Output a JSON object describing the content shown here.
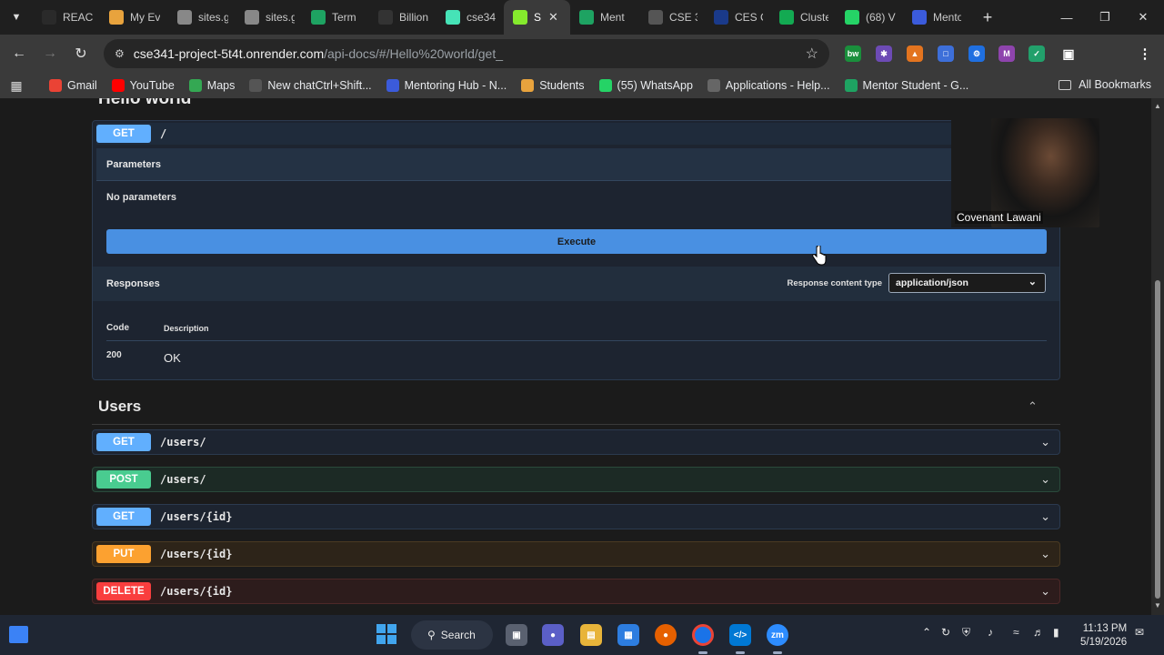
{
  "browser": {
    "tabs": [
      {
        "label": "REAC",
        "icon": "openai-icon",
        "color": "#2a2a2a",
        "active": false
      },
      {
        "label": "My Ev",
        "icon": "people-icon",
        "color": "#e8a33d",
        "active": false
      },
      {
        "label": "sites.g",
        "icon": "page-icon",
        "color": "#888888",
        "active": false
      },
      {
        "label": "sites.g",
        "icon": "page-icon",
        "color": "#888888",
        "active": false
      },
      {
        "label": "Term",
        "icon": "sheets-icon",
        "color": "#1ea362",
        "active": false
      },
      {
        "label": "Billion",
        "icon": "github-icon",
        "color": "#333333",
        "active": false
      },
      {
        "label": "cse34",
        "icon": "render-icon",
        "color": "#46e3b7",
        "active": false
      },
      {
        "label": "S",
        "icon": "swagger-icon",
        "color": "#85ea2d",
        "active": true
      },
      {
        "label": "Ment",
        "icon": "sheets-icon",
        "color": "#1ea362",
        "active": false
      },
      {
        "label": "CSE 3",
        "icon": "course-icon",
        "color": "#555555",
        "active": false
      },
      {
        "label": "CES C",
        "icon": "ces-icon",
        "color": "#1a3a8a",
        "active": false
      },
      {
        "label": "Cluste",
        "icon": "mongodb-icon",
        "color": "#13aa52",
        "active": false
      },
      {
        "label": "(68) V",
        "icon": "whatsapp-icon",
        "color": "#25d366",
        "active": false
      },
      {
        "label": "Mento",
        "icon": "mentoring-icon",
        "color": "#3b5bdb",
        "active": false
      }
    ],
    "url_host": "cse341-project-5t4t.onrender.com",
    "url_path": "/api-docs/#/Hello%20world/get_",
    "bookmarks": [
      {
        "label": "Gmail",
        "icon": "gmail-icon",
        "color": "#ea4335"
      },
      {
        "label": "YouTube",
        "icon": "youtube-icon",
        "color": "#ff0000"
      },
      {
        "label": "Maps",
        "icon": "maps-icon",
        "color": "#34a853"
      },
      {
        "label": "New chatCtrl+Shift...",
        "icon": "openai-icon",
        "color": "#555555"
      },
      {
        "label": "Mentoring Hub - N...",
        "icon": "mentoring-icon",
        "color": "#3b5bdb"
      },
      {
        "label": "Students",
        "icon": "people-icon",
        "color": "#e8a33d"
      },
      {
        "label": "(55) WhatsApp",
        "icon": "whatsapp-icon",
        "color": "#25d366"
      },
      {
        "label": "Applications - Help...",
        "icon": "globe-icon",
        "color": "#666666"
      },
      {
        "label": "Mentor Student - G...",
        "icon": "sheets-icon",
        "color": "#1ea362"
      }
    ],
    "all_bookmarks": "All Bookmarks"
  },
  "hello_world": {
    "section_title": "Hello world",
    "method": "GET",
    "path": "/",
    "parameters_label": "Parameters",
    "no_parameters": "No parameters",
    "execute_label": "Execute",
    "responses_label": "Responses",
    "content_type_label": "Response content type",
    "content_type_value": "application/json",
    "code_header": "Code",
    "description_header": "Description",
    "responses": [
      {
        "code": "200",
        "description": "OK"
      }
    ]
  },
  "users": {
    "title": "Users",
    "operations": [
      {
        "method": "GET",
        "path": "/users/",
        "kind": "get"
      },
      {
        "method": "POST",
        "path": "/users/",
        "kind": "post"
      },
      {
        "method": "GET",
        "path": "/users/{id}",
        "kind": "get"
      },
      {
        "method": "PUT",
        "path": "/users/{id}",
        "kind": "put"
      },
      {
        "method": "DELETE",
        "path": "/users/{id}",
        "kind": "delete"
      }
    ]
  },
  "webcam": {
    "name": "Covenant Lawani"
  },
  "taskbar": {
    "search_label": "Search",
    "time": "11:13 PM",
    "date": "5/19/2026"
  }
}
